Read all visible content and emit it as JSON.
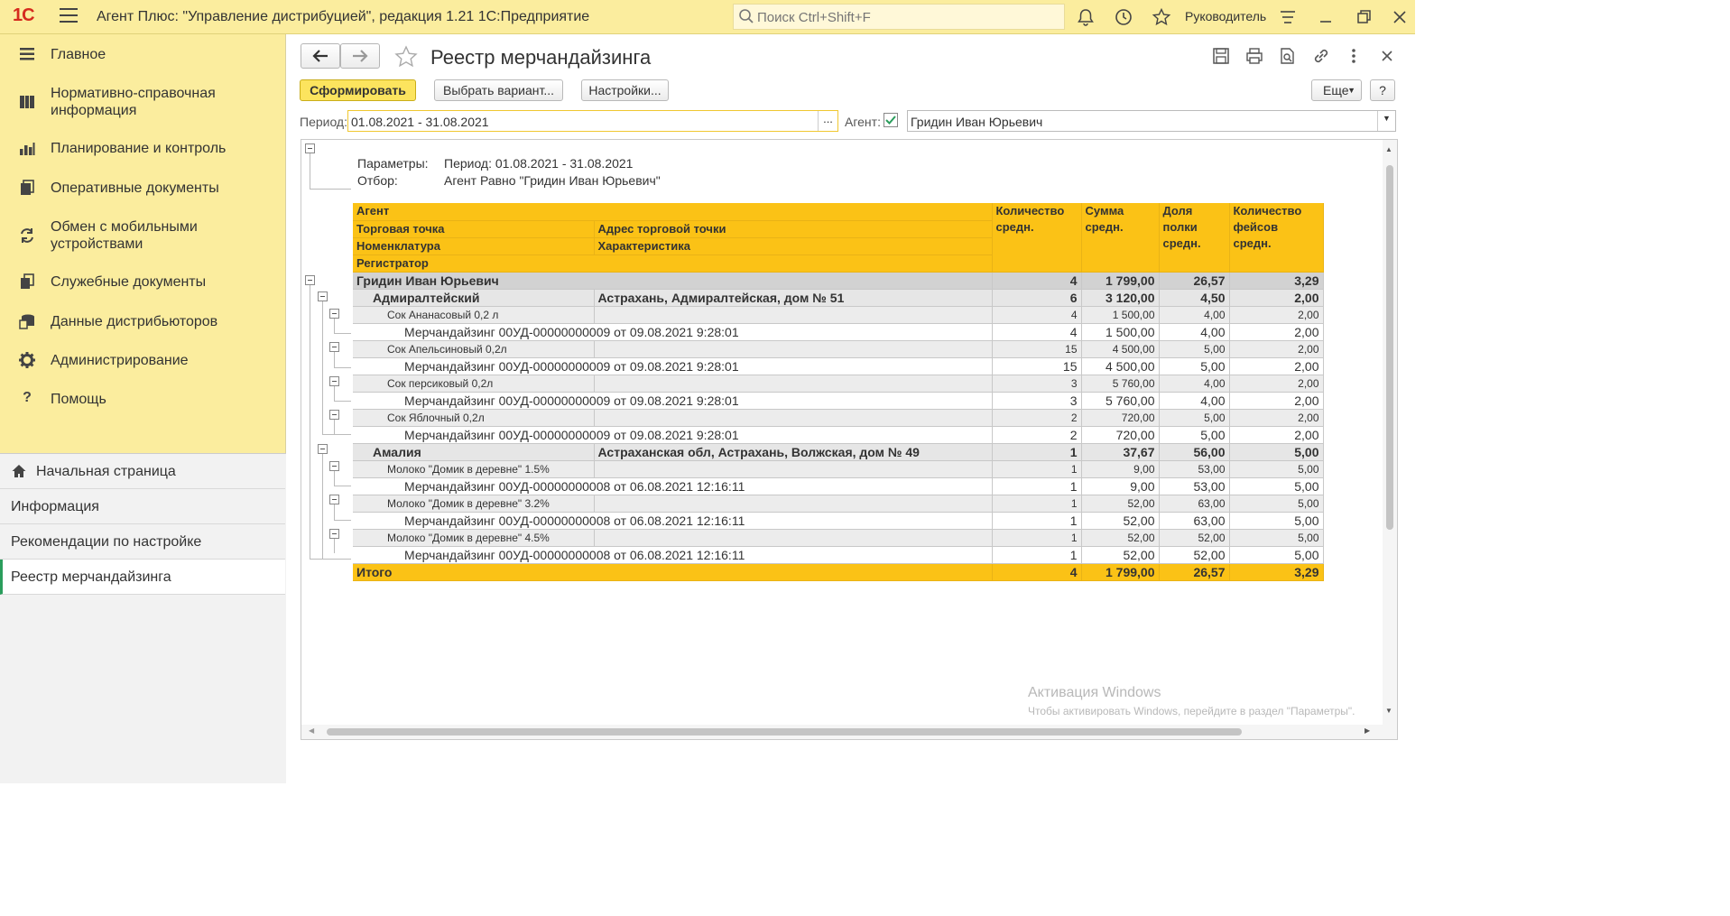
{
  "app": {
    "logo": "1С",
    "title": "Агент Плюс: \"Управление дистрибуцией\", редакция 1.21 1С:Предприятие",
    "search_placeholder": "Поиск Ctrl+Shift+F",
    "user": "Руководитель"
  },
  "sidebar": {
    "items": [
      {
        "label": "Главное",
        "icon": "hamburger-list-icon"
      },
      {
        "label": "Нормативно-справочная информация",
        "icon": "book-icon"
      },
      {
        "label": "Планирование и контроль",
        "icon": "bar-chart-icon"
      },
      {
        "label": "Оперативные документы",
        "icon": "documents-icon"
      },
      {
        "label": "Обмен с мобильными устройствами",
        "icon": "sync-icon"
      },
      {
        "label": "Служебные документы",
        "icon": "documents-stack-icon"
      },
      {
        "label": "Данные дистрибьюторов",
        "icon": "database-icon"
      },
      {
        "label": "Администрирование",
        "icon": "gear-icon"
      },
      {
        "label": "Помощь",
        "icon": "question-icon"
      }
    ],
    "lower": [
      {
        "label": "Начальная страница",
        "icon": "home-icon"
      },
      {
        "label": "Информация"
      },
      {
        "label": "Рекомендации по настройке"
      },
      {
        "label": "Реестр мерчандайзинга"
      }
    ]
  },
  "page": {
    "title": "Реестр мерчандайзинга",
    "buttons": {
      "generate": "Сформировать",
      "choose_variant": "Выбрать вариант...",
      "settings": "Настройки...",
      "more": "Еще",
      "help": "?"
    },
    "period_label": "Период:",
    "period_value": "01.08.2021 - 31.08.2021",
    "period_btn": "...",
    "agent_label": "Агент:",
    "agent_value": "Гридин Иван Юрьевич"
  },
  "report": {
    "params_label": "Параметры:",
    "params_value": "Период: 01.08.2021 - 31.08.2021",
    "filter_label": "Отбор:",
    "filter_value": "Агент Равно \"Гридин Иван Юрьевич\"",
    "headers": {
      "agent": "Агент",
      "outlet": "Торговая точка",
      "outlet_address": "Адрес торговой точки",
      "nomenclature": "Номенклатура",
      "characteristic": "Характеристика",
      "registrar": "Регистратор",
      "qty_1": "Количество",
      "qty_2": "средн.",
      "sum_1": "Сумма",
      "sum_2": "средн.",
      "share_1": "Доля",
      "share_2": "полки",
      "share_3": "средн.",
      "faces_1": "Количество",
      "faces_2": "фейсов",
      "faces_3": "средн."
    },
    "agent_row": {
      "name": "Гридин Иван Юрьевич",
      "qty": "4",
      "sum": "1 799,00",
      "share": "26,57",
      "faces": "3,29"
    },
    "outlets": [
      {
        "name": "Адмиралтейский",
        "address": "Астрахань, Адмиралтейская, дом № 51",
        "qty": "6",
        "sum": "3 120,00",
        "share": "4,50",
        "faces": "2,00",
        "items": [
          {
            "name": "Сок Ананасовый 0,2 л",
            "qty": "4",
            "sum": "1 500,00",
            "share": "4,00",
            "faces": "2,00",
            "doc": "Мерчандайзинг 00УД-00000000009 от 09.08.2021 9:28:01",
            "dqty": "4",
            "dsum": "1 500,00",
            "dshare": "4,00",
            "dfaces": "2,00"
          },
          {
            "name": "Сок Апельсиновый 0,2л",
            "qty": "15",
            "sum": "4 500,00",
            "share": "5,00",
            "faces": "2,00",
            "doc": "Мерчандайзинг 00УД-00000000009 от 09.08.2021 9:28:01",
            "dqty": "15",
            "dsum": "4 500,00",
            "dshare": "5,00",
            "dfaces": "2,00"
          },
          {
            "name": "Сок персиковый 0,2л",
            "qty": "3",
            "sum": "5 760,00",
            "share": "4,00",
            "faces": "2,00",
            "doc": "Мерчандайзинг 00УД-00000000009 от 09.08.2021 9:28:01",
            "dqty": "3",
            "dsum": "5 760,00",
            "dshare": "4,00",
            "dfaces": "2,00"
          },
          {
            "name": "Сок Яблочный 0,2л",
            "qty": "2",
            "sum": "720,00",
            "share": "5,00",
            "faces": "2,00",
            "doc": "Мерчандайзинг 00УД-00000000009 от 09.08.2021 9:28:01",
            "dqty": "2",
            "dsum": "720,00",
            "dshare": "5,00",
            "dfaces": "2,00"
          }
        ]
      },
      {
        "name": "Амалия",
        "address": "Астраханская обл, Астрахань, Волжская, дом № 49",
        "qty": "1",
        "sum": "37,67",
        "share": "56,00",
        "faces": "5,00",
        "items": [
          {
            "name": "Молоко \"Домик в деревне\" 1.5%",
            "qty": "1",
            "sum": "9,00",
            "share": "53,00",
            "faces": "5,00",
            "doc": "Мерчандайзинг 00УД-00000000008 от 06.08.2021 12:16:11",
            "dqty": "1",
            "dsum": "9,00",
            "dshare": "53,00",
            "dfaces": "5,00"
          },
          {
            "name": "Молоко \"Домик в деревне\" 3.2%",
            "qty": "1",
            "sum": "52,00",
            "share": "63,00",
            "faces": "5,00",
            "doc": "Мерчандайзинг 00УД-00000000008 от 06.08.2021 12:16:11",
            "dqty": "1",
            "dsum": "52,00",
            "dshare": "63,00",
            "dfaces": "5,00"
          },
          {
            "name": "Молоко \"Домик в деревне\" 4.5%",
            "qty": "1",
            "sum": "52,00",
            "share": "52,00",
            "faces": "5,00",
            "doc": "Мерчандайзинг 00УД-00000000008 от 06.08.2021 12:16:11",
            "dqty": "1",
            "dsum": "52,00",
            "dshare": "52,00",
            "dfaces": "5,00"
          }
        ]
      }
    ],
    "total": {
      "label": "Итого",
      "qty": "4",
      "sum": "1 799,00",
      "share": "26,57",
      "faces": "3,29"
    }
  },
  "watermark": {
    "line1": "Активация Windows",
    "line2": "Чтобы активировать Windows, перейдите в раздел \"Параметры\"."
  }
}
